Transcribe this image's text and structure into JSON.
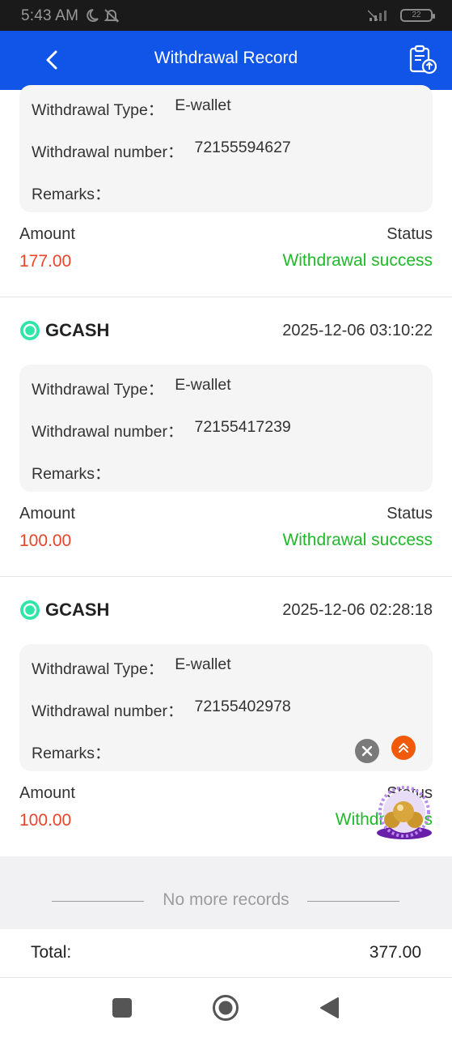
{
  "status_bar": {
    "time": "5:43 AM",
    "battery": "22"
  },
  "header": {
    "title": "Withdrawal Record"
  },
  "partial_record": {
    "type_label": "Withdrawal Type：",
    "type_value": "E-wallet",
    "number_label": "Withdrawal number：",
    "number_value": "72155594627",
    "remarks_label": "Remarks：",
    "amount_label": "Amount",
    "amount": "177.00",
    "status_label": "Status",
    "status": "Withdrawal success"
  },
  "records": [
    {
      "brand": "GCASH",
      "date": "2025-12-06 03:10:22",
      "type_label": "Withdrawal Type：",
      "type_value": "E-wallet",
      "number_label": "Withdrawal number：",
      "number_value": "72155417239",
      "remarks_label": "Remarks：",
      "amount_label": "Amount",
      "amount": "100.00",
      "status_label": "Status",
      "status": "Withdrawal success"
    },
    {
      "brand": "GCASH",
      "date": "2025-12-06 02:28:18",
      "type_label": "Withdrawal Type：",
      "type_value": "E-wallet",
      "number_label": "Withdrawal number：",
      "number_value": "72155402978",
      "remarks_label": "Remarks：",
      "amount_label": "Amount",
      "amount": "100.00",
      "status_label": "Status",
      "status": "Withdrawal s"
    }
  ],
  "footer": {
    "no_more": "No more records"
  },
  "total": {
    "label": "Total:",
    "value": "377.00"
  },
  "colors": {
    "header_bg": "#1155e8",
    "amount": "#e8452a",
    "success": "#1fb92a",
    "gcash": "#2ee6a8"
  },
  "icons": {
    "back": "chevron-left-icon",
    "export": "clipboard-upload-icon",
    "brand": "gcash-logo-icon",
    "close": "close-icon",
    "up": "double-chevron-up-icon",
    "nav_recent": "square-icon",
    "nav_home": "circle-icon",
    "nav_back": "triangle-back-icon"
  }
}
